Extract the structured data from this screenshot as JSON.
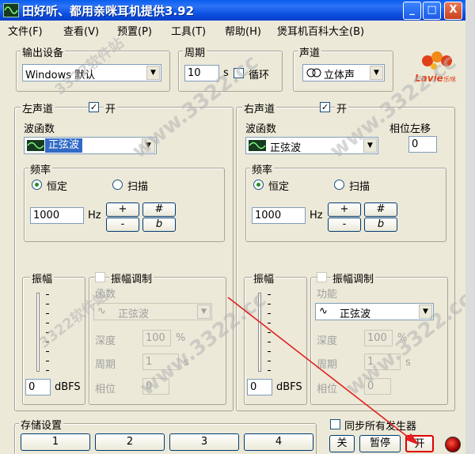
{
  "window": {
    "title": "田好听、都用亲咪耳机提供3.92",
    "controls": [
      "_",
      "□",
      "X"
    ]
  },
  "menu": [
    "文件(F)",
    "查看(V)",
    "预置(P)",
    "工具(T)",
    "帮助(H)",
    "煲耳机百科大全(B)"
  ],
  "output": {
    "label": "输出设备",
    "value": "Windows 默认"
  },
  "period": {
    "label": "周期",
    "value": "10",
    "unit": "s",
    "loop_label": "循环"
  },
  "channel": {
    "label": "声道",
    "value": "立体声"
  },
  "logo": {
    "text": "Lavie",
    "sub": "乐咪"
  },
  "left": {
    "title": "左声道",
    "on_label": "开",
    "wave_label": "波函数",
    "wave_value": "正弦波",
    "freq_label": "频率",
    "fixed": "恒定",
    "sweep": "扫描",
    "freq_value": "1000",
    "hz": "Hz",
    "plus": "+",
    "minus": "-",
    "sharp": "#",
    "flat": "b",
    "amp_label": "振幅",
    "amp_value": "0",
    "dbfs": "dBFS",
    "mod_label": "振幅调制",
    "func_label": "函数",
    "func_value": "正弦波",
    "depth_label": "深度",
    "depth_value": "100",
    "percent": "%",
    "period_label": "周期",
    "period_value": "1",
    "s": "s",
    "phase_label": "相位",
    "phase_value": "0"
  },
  "right": {
    "title": "右声道",
    "on_label": "开",
    "wave_label": "波函数",
    "wave_value": "正弦波",
    "phase_shift_label": "相位左移",
    "phase_shift_value": "0",
    "freq_label": "频率",
    "fixed": "恒定",
    "sweep": "扫描",
    "freq_value": "1000",
    "hz": "Hz",
    "plus": "+",
    "minus": "-",
    "sharp": "#",
    "flat": "b",
    "amp_label": "振幅",
    "amp_value": "0",
    "dbfs": "dBFS",
    "mod_label": "振幅调制",
    "func_label": "功能",
    "func_value": "正弦波",
    "depth_label": "深度",
    "depth_value": "100",
    "percent": "%",
    "period_label": "周期",
    "period_value": "1",
    "s": "s",
    "phase_label": "相位",
    "phase_value": "0"
  },
  "storage": {
    "label": "存储设置",
    "slots": [
      "1",
      "2",
      "3",
      "4"
    ]
  },
  "sync_label": "同步所有发生器",
  "buttons": {
    "off": "关",
    "pause": "暂停",
    "on": "开"
  },
  "watermarks": [
    "3322软件站",
    "www.3322.cc"
  ]
}
